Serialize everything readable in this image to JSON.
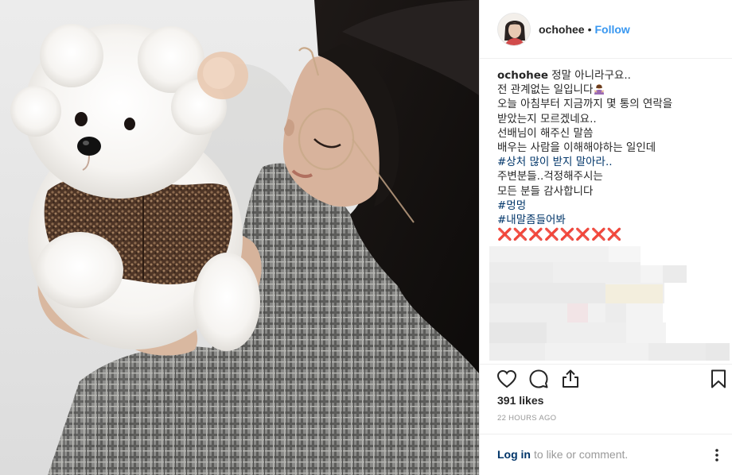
{
  "header": {
    "username": "ochohee",
    "separator": "•",
    "follow_label": "Follow",
    "avatar_icon": "avatar"
  },
  "caption": {
    "username": "ochohee",
    "lines": [
      "정말 아니라구요..",
      "전 관계없는 일입니다",
      "오늘 아침부터 지금까지 몇 통의 연락을",
      "받았는지 모르겠네요..",
      "선배님이 해주신 말씀",
      "배우는 사람을 이해해야하는 일인데"
    ],
    "hashtag_1": "#상처 많이 받지 말아라..",
    "lines_2": [
      "주변분들..걱정해주시는",
      "모든 분들 감사합니다"
    ],
    "hashtag_2": "#멍멍",
    "hashtag_3": "#내말좀들어봐",
    "x_marks": "❌❌❌❌❌❌❌❌"
  },
  "actions": {
    "like_icon": "heart-icon",
    "comment_icon": "comment-icon",
    "share_icon": "share-icon",
    "save_icon": "bookmark-icon"
  },
  "likes_text": "391 likes",
  "timestamp": "22 HOURS AGO",
  "comment_bar": {
    "login_label": "Log in",
    "rest_text": "to like or comment.",
    "more_icon": "more-options-icon"
  },
  "colors": {
    "link_blue": "#3897f0",
    "hashtag": "#003569",
    "muted": "#999999",
    "border": "#efefef",
    "x_red": "#dd2e44"
  }
}
